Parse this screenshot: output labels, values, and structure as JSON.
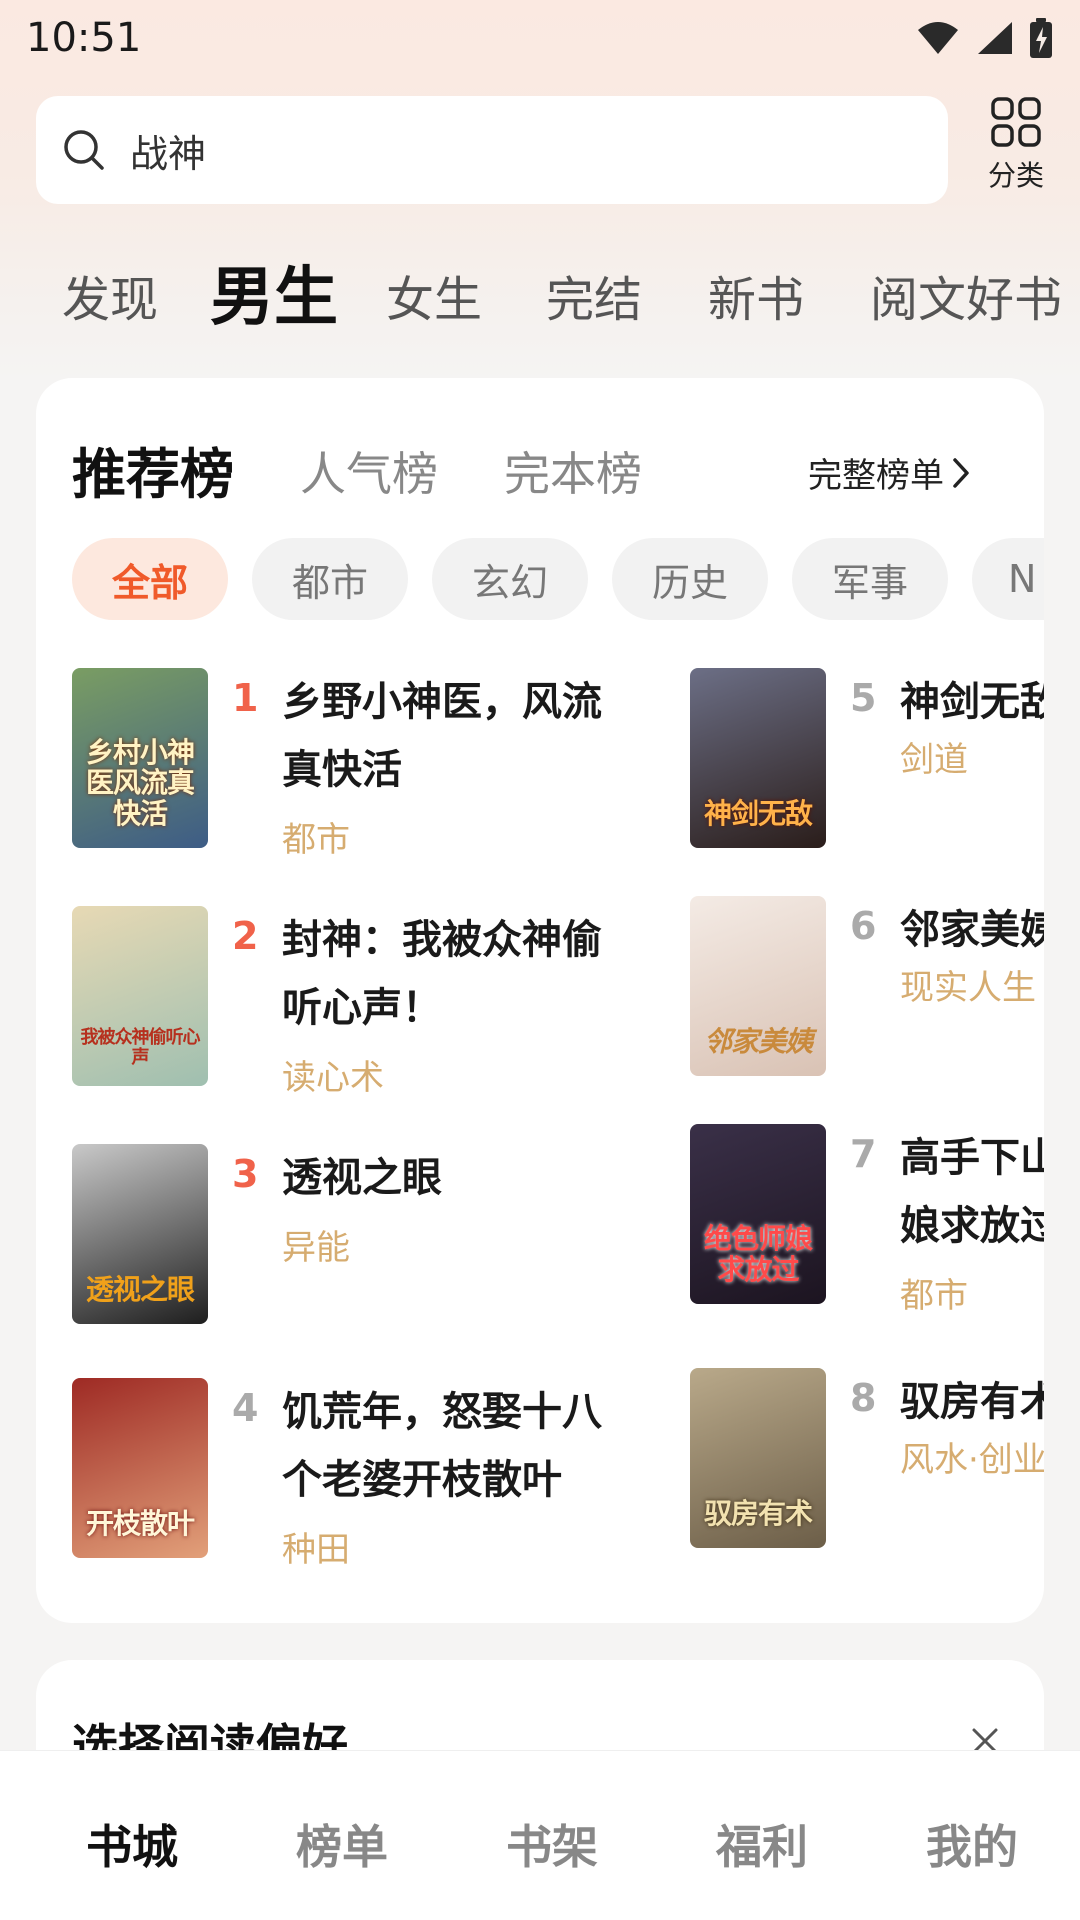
{
  "status_bar": {
    "time": "10:51"
  },
  "search": {
    "placeholder": "战神",
    "category_label": "分类"
  },
  "channel_tabs": [
    {
      "label": "发现",
      "active": false
    },
    {
      "label": "男生",
      "active": true
    },
    {
      "label": "女生",
      "active": false
    },
    {
      "label": "完结",
      "active": false
    },
    {
      "label": "新书",
      "active": false
    },
    {
      "label": "阅文好书",
      "active": false
    }
  ],
  "rank_card": {
    "tabs": [
      {
        "label": "推荐榜",
        "active": true
      },
      {
        "label": "人气榜",
        "active": false
      },
      {
        "label": "完本榜",
        "active": false
      }
    ],
    "full_list_label": "完整榜单",
    "filters": [
      {
        "label": "全部",
        "active": true
      },
      {
        "label": "都市",
        "active": false
      },
      {
        "label": "玄幻",
        "active": false
      },
      {
        "label": "历史",
        "active": false
      },
      {
        "label": "军事",
        "active": false
      },
      {
        "label": "N",
        "active": false
      }
    ],
    "books": [
      {
        "rank": "1",
        "title": "乡野小神医，风流真快活",
        "tag": "都市",
        "cover_text": "乡村小神医风流真快活",
        "cover_colors": [
          "#7a9d63",
          "#3d5c86"
        ]
      },
      {
        "rank": "2",
        "title": "封神：我被众神偷听心声！",
        "tag": "读心术",
        "cover_text": "我被众神偷听心声",
        "cover_colors": [
          "#e7d9b4",
          "#9fbfb0"
        ]
      },
      {
        "rank": "3",
        "title": "透视之眼",
        "tag": "异能",
        "cover_text": "透视之眼",
        "cover_colors": [
          "#c9c9c9",
          "#1e1e1e"
        ]
      },
      {
        "rank": "4",
        "title": "饥荒年，怒娶十八个老婆开枝散叶",
        "tag": "种田",
        "cover_text": "开枝散叶",
        "cover_colors": [
          "#9e2a24",
          "#e2a07a"
        ]
      },
      {
        "rank": "5",
        "title": "神剑无敌",
        "tag": "剑道",
        "cover_text": "神剑无敌",
        "cover_colors": [
          "#6c6f86",
          "#2a1d1a"
        ]
      },
      {
        "rank": "6",
        "title": "邻家美姨",
        "tag": "现实人生",
        "cover_text": "邻家美姨",
        "cover_colors": [
          "#f4ebe5",
          "#d9c2b4"
        ]
      },
      {
        "rank": "7",
        "title": "高手下山，绝色师娘求放过",
        "tag": "都市",
        "cover_text": "绝色师娘求放过",
        "cover_colors": [
          "#3a3048",
          "#1c1420"
        ]
      },
      {
        "rank": "8",
        "title": "驭房有术",
        "tag": "风水·创业",
        "cover_text": "驭房有术",
        "cover_colors": [
          "#b9a98a",
          "#6c5e48"
        ]
      }
    ]
  },
  "preference_card": {
    "title": "选择阅读偏好"
  },
  "bottom_nav": [
    {
      "label": "书城",
      "active": true
    },
    {
      "label": "榜单",
      "active": false
    },
    {
      "label": "书架",
      "active": false
    },
    {
      "label": "福利",
      "active": false
    },
    {
      "label": "我的",
      "active": false
    }
  ],
  "colors": {
    "accent": "#f05a2a",
    "rank_highlight": "#f0624a",
    "tag": "#d6ac70"
  }
}
